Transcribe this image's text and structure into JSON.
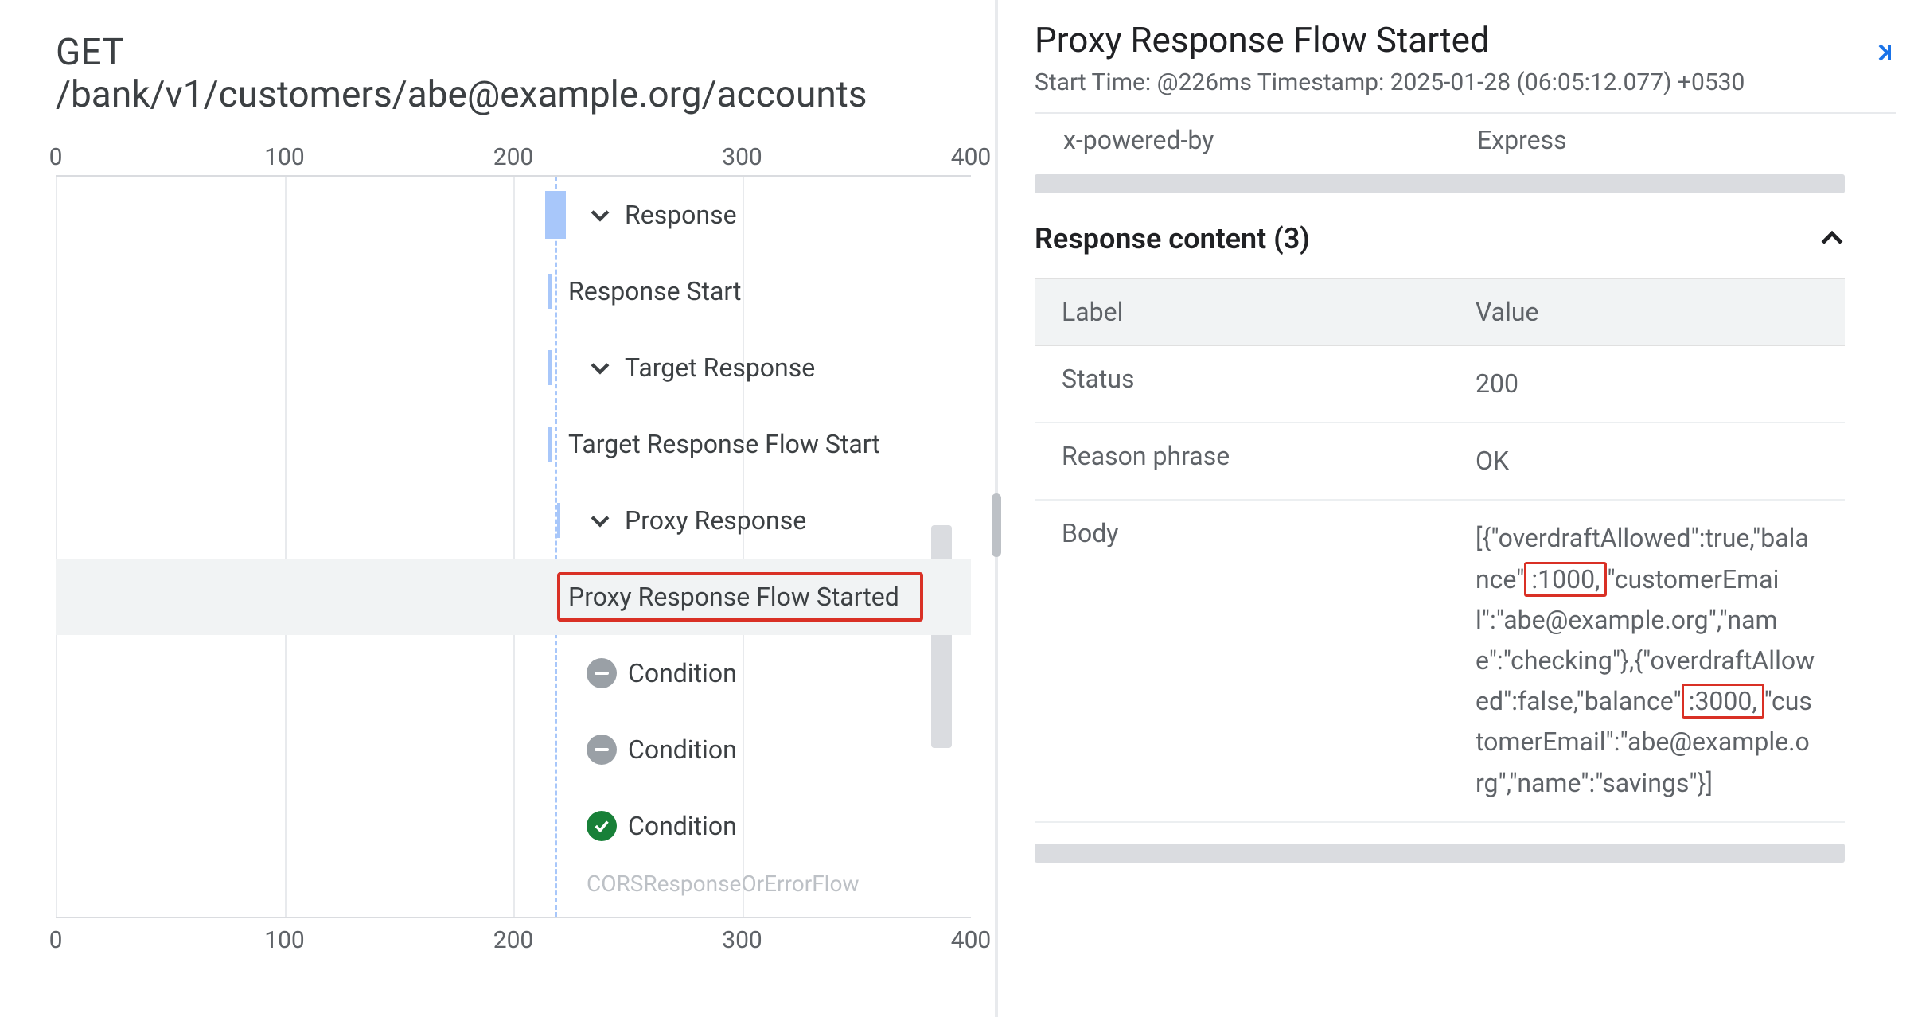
{
  "request": {
    "method": "GET",
    "path": "/bank/v1/customers/abe@example.org/accounts"
  },
  "axis": {
    "ticks": [
      "0",
      "100",
      "200",
      "300",
      "400"
    ]
  },
  "timeline": {
    "dashed_at_pct": 54.5,
    "rows": [
      {
        "kind": "group",
        "label": "Response",
        "bar": {
          "left_pct": 53.5,
          "width_pct": 2.2
        },
        "content_left_pct": 58
      },
      {
        "kind": "item",
        "label": "Response Start",
        "tick_pct": 53.8,
        "content_left_pct": 56
      },
      {
        "kind": "group",
        "label": "Target Response",
        "tick_pct": 53.8,
        "content_left_pct": 58
      },
      {
        "kind": "item",
        "label": "Target Response Flow Start",
        "tick_pct": 53.8,
        "content_left_pct": 56
      },
      {
        "kind": "group",
        "label": "Proxy Response",
        "tick_pct": 54.8,
        "content_left_pct": 58
      },
      {
        "kind": "item",
        "label": "Proxy Response Flow Started",
        "tick_pct": 54.8,
        "content_left_pct": 56,
        "selected": true,
        "clip": true
      },
      {
        "kind": "cond",
        "label": "Condition",
        "icon": "minus",
        "content_left_pct": 58
      },
      {
        "kind": "cond",
        "label": "Condition",
        "icon": "minus",
        "content_left_pct": 58
      },
      {
        "kind": "cond",
        "label": "Condition",
        "icon": "check",
        "content_left_pct": 58
      },
      {
        "kind": "peek",
        "label": "CORSResponseOrErrorFlow",
        "content_left_pct": 58
      }
    ]
  },
  "detail": {
    "title": "Proxy Response Flow Started",
    "subtitle": "Start Time: @226ms Timestamp: 2025-01-28 (06:05:12.077) +0530",
    "prev_header": {
      "label": "x-powered-by",
      "value": "Express"
    },
    "section_title": "Response content (3)",
    "table": {
      "columns": {
        "label": "Label",
        "value": "Value"
      },
      "rows": [
        {
          "label": "Status",
          "value": "200"
        },
        {
          "label": "Reason phrase",
          "value": "OK"
        }
      ],
      "body_row_label": "Body",
      "body_segments": [
        {
          "t": "[{\"overdraftAllowed\":true,\"balance\""
        },
        {
          "t": ":1000,",
          "hl": true
        },
        {
          "t": "\"customerEmail\":\"abe@example.org\",\"name\":\"checking\"},{\"overdraftAllowed\":false,\"balance\""
        },
        {
          "t": ":3000,",
          "hl": true
        },
        {
          "t": "\"customerEmail\":\"abe@example.org\",\"name\":\"savings\"}]"
        }
      ]
    }
  }
}
